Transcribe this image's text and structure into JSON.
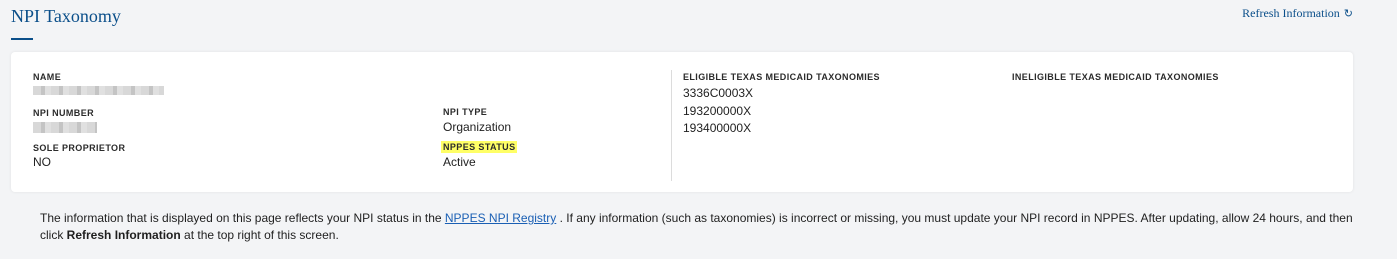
{
  "header": {
    "title": "NPI Taxonomy",
    "refresh_label": "Refresh Information",
    "refresh_icon": "refresh-icon"
  },
  "details": {
    "name_label": "NAME",
    "npi_number_label": "NPI NUMBER",
    "sole_proprietor_label": "SOLE PROPRIETOR",
    "sole_proprietor_value": "NO",
    "npi_type_label": "NPI TYPE",
    "npi_type_value": "Organization",
    "nppes_status_label": "NPPES STATUS",
    "nppes_status_value": "Active"
  },
  "taxonomies": {
    "eligible_label": "ELIGIBLE TEXAS MEDICAID TAXONOMIES",
    "eligible_items": [
      "3336C0003X",
      "193200000X",
      "193400000X"
    ],
    "ineligible_label": "INELIGIBLE TEXAS MEDICAID TAXONOMIES"
  },
  "footer": {
    "text_before_link": "The information that is displayed on this page reflects your NPI status in the ",
    "link_text": "NPPES NPI Registry",
    "text_after_link": " . If any information (such as taxonomies) is incorrect or missing, you must update your NPI record in NPPES. After updating, allow 24 hours, and then click ",
    "bold_text": "Refresh Information",
    "text_end": " at the top right of this screen."
  },
  "colors": {
    "title": "#0b4f8a",
    "highlight": "#ffff66",
    "link": "#1a5fb4",
    "background": "#f3f4f6"
  }
}
